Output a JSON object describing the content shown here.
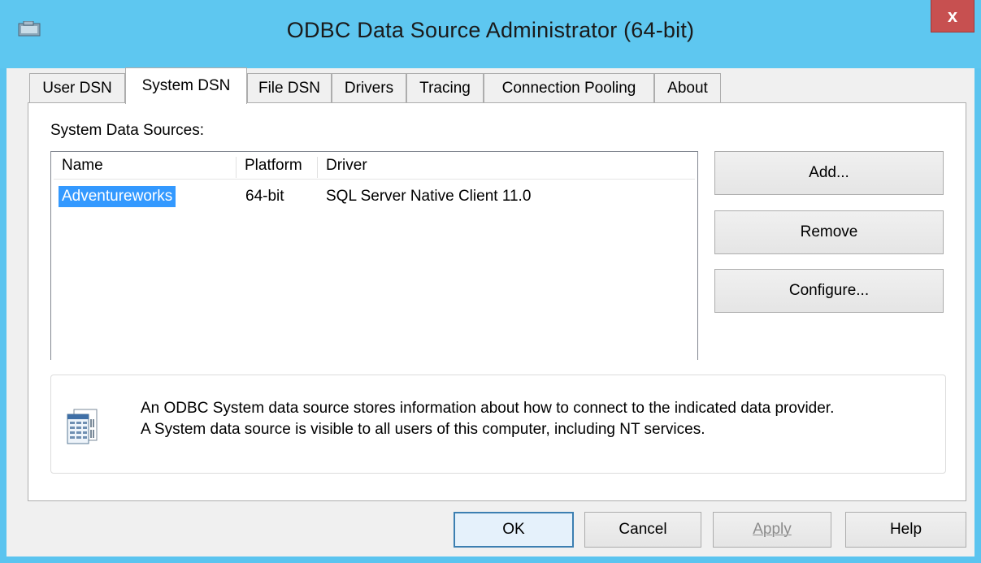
{
  "window": {
    "title": "ODBC Data Source Administrator (64-bit)",
    "close_label": "x"
  },
  "tabs": [
    {
      "label": "User DSN",
      "active": false
    },
    {
      "label": "System DSN",
      "active": true
    },
    {
      "label": "File DSN",
      "active": false
    },
    {
      "label": "Drivers",
      "active": false
    },
    {
      "label": "Tracing",
      "active": false
    },
    {
      "label": "Connection Pooling",
      "active": false
    },
    {
      "label": "About",
      "active": false
    }
  ],
  "panel": {
    "section_label": "System Data Sources:",
    "columns": [
      "Name",
      "Platform",
      "Driver"
    ],
    "rows": [
      {
        "name": "Adventureworks",
        "platform": "64-bit",
        "driver": "SQL Server Native Client 11.0",
        "selected": true
      }
    ],
    "buttons": {
      "add": "Add...",
      "remove": "Remove",
      "configure": "Configure..."
    },
    "info": {
      "line1": "An ODBC System data source stores information about how to connect to the indicated data provider.",
      "line2": "A System data source is visible to all users of this computer, including NT services."
    }
  },
  "footer": {
    "ok": "OK",
    "cancel": "Cancel",
    "apply": "Apply",
    "help": "Help"
  },
  "colors": {
    "titlebar": "#5ec7f0",
    "close": "#c75050",
    "selection": "#3399ff"
  }
}
